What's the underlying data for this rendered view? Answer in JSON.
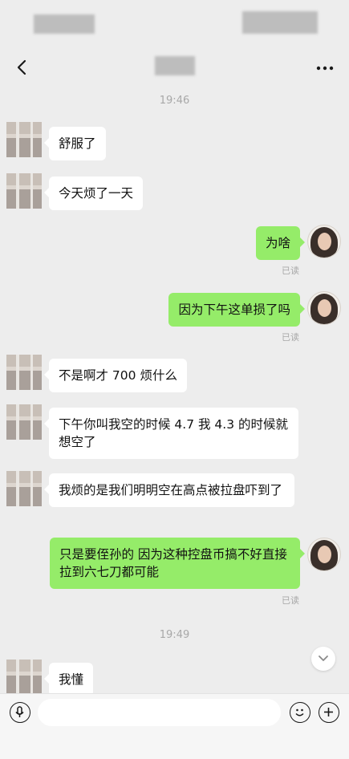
{
  "status_bar": {
    "time": "",
    "indicators": ""
  },
  "nav": {
    "title": "",
    "back_icon": "chevron-left-icon",
    "more_icon": "more-dots-icon"
  },
  "chat": {
    "timestamps": [
      "19:46",
      "19:49"
    ],
    "read_label": "已读",
    "messages": [
      {
        "side": "in",
        "text": "舒服了"
      },
      {
        "side": "in",
        "text": "今天烦了一天"
      },
      {
        "side": "out",
        "text": "为啥"
      },
      {
        "side": "out",
        "text": "因为下午这单损了吗"
      },
      {
        "side": "in",
        "text": "不是啊才 700 烦什么"
      },
      {
        "side": "in",
        "text": "下午你叫我空的时候 4.7 我 4.3 的时候就想空了"
      },
      {
        "side": "in",
        "text": "我烦的是我们明明空在高点被拉盘吓到了"
      },
      {
        "side": "out",
        "text": "只是要侄孙的 因为这种控盘币搞不好直接拉到六七刀都可能"
      },
      {
        "side": "in",
        "text": "我懂"
      }
    ]
  },
  "input_bar": {
    "voice_icon": "voice-icon",
    "emoji_icon": "emoji-icon",
    "plus_icon": "plus-icon",
    "placeholder": ""
  }
}
